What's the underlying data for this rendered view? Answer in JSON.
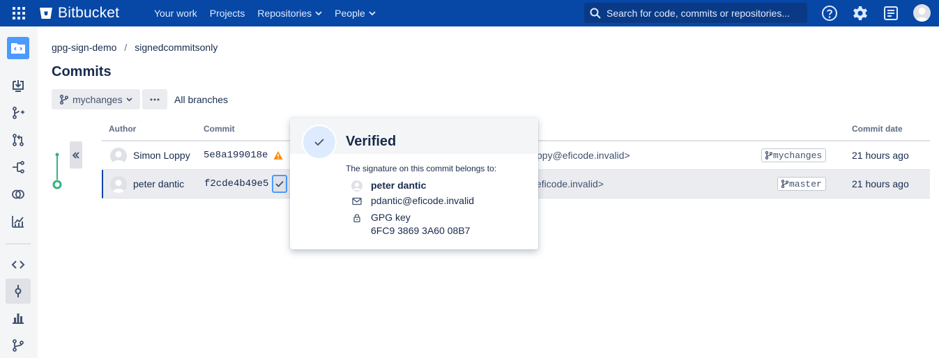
{
  "topnav": {
    "logo_text": "Bitbucket",
    "links": [
      "Your work",
      "Projects",
      "Repositories",
      "People"
    ],
    "search_placeholder": "Search for code, commits or repositories...",
    "bg_color": "#0747a6"
  },
  "breadcrumb": {
    "project": "gpg-sign-demo",
    "separator": "/",
    "repo": "signedcommitsonly"
  },
  "page": {
    "title": "Commits",
    "branch": "mychanges",
    "all_branches": "All branches"
  },
  "table": {
    "headers": {
      "author": "Author",
      "commit": "Commit",
      "date": "Commit date"
    },
    "rows": [
      {
        "author": "Simon Loppy",
        "hash": "5e8a199018e",
        "email_fragment": "ppy@eficode.invalid>",
        "branch": "mychanges",
        "date": "21 hours ago",
        "status": "warning-icon"
      },
      {
        "author": "peter dantic",
        "hash": "f2cde4b49e5",
        "email_fragment": "eficode.invalid>",
        "branch": "master",
        "date": "21 hours ago",
        "status": "verified-icon"
      }
    ]
  },
  "popup": {
    "title": "Verified",
    "subtitle": "The signature on this commit belongs to:",
    "name": "peter dantic",
    "email": "pdantic@eficode.invalid",
    "key_label": "GPG key",
    "key_id": "6FC9 3869 3A60 08B7"
  },
  "colors": {
    "accent": "#0052cc",
    "graph": "#36b37e",
    "warning": "#ff8b00"
  }
}
